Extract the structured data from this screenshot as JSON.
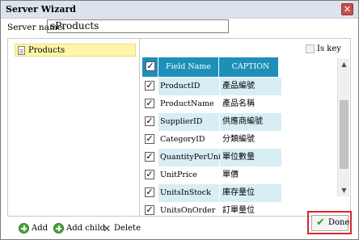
{
  "window": {
    "title": "Server Wizard"
  },
  "server": {
    "label": "Server name:",
    "value": "sProducts"
  },
  "tree": {
    "items": [
      {
        "label": "Products",
        "icon": "document-icon"
      }
    ]
  },
  "iskey": {
    "label": "Is key",
    "checked": false
  },
  "grid": {
    "headers": {
      "field": "Field Name",
      "caption": "CAPTION"
    },
    "rows": [
      {
        "field": "ProductID",
        "caption": "產品編號",
        "checked": true
      },
      {
        "field": "ProductName",
        "caption": "產品名稱",
        "checked": true
      },
      {
        "field": "SupplierID",
        "caption": "供應商編號",
        "checked": true
      },
      {
        "field": "CategoryID",
        "caption": "分類編號",
        "checked": true
      },
      {
        "field": "QuantityPerUnit",
        "caption": "單位數量",
        "checked": true
      },
      {
        "field": "UnitPrice",
        "caption": "單價",
        "checked": true
      },
      {
        "field": "UnitsInStock",
        "caption": "庫存量位",
        "checked": true
      },
      {
        "field": "UnitsOnOrder",
        "caption": "訂單量位",
        "checked": true
      }
    ]
  },
  "toolbar": {
    "add": "Add",
    "add_child": "Add child",
    "delete": "Delete",
    "done": "Done"
  },
  "colors": {
    "header": "#1d8fb8",
    "row_highlight": "#d8eef5",
    "selected_tree": "#fff5a8",
    "done_border": "#d8262c"
  }
}
